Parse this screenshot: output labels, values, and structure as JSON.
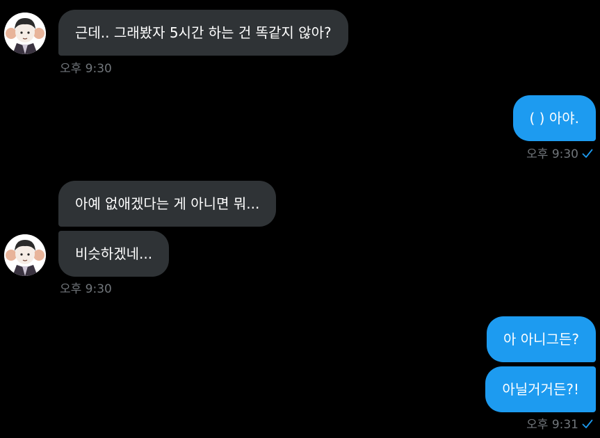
{
  "messages": [
    {
      "direction": "in",
      "text": "근데.. 그래봤자 5시간 하는 건 똑같지 않아?",
      "time": "오후 9:30"
    },
    {
      "direction": "out",
      "text": "( ) 아야.",
      "time": "오후 9:30"
    },
    {
      "direction": "in",
      "text": "아예 없애겠다는 게 아니면 뭐..."
    },
    {
      "direction": "in",
      "text": "비슷하겠네...",
      "time": "오후 9:30"
    },
    {
      "direction": "out",
      "text": "아 아니그든?"
    },
    {
      "direction": "out",
      "text": "아닐거거든?!",
      "time": "오후 9:31"
    }
  ],
  "icons": {
    "read_receipt": "check-icon",
    "avatar": "avatar-icon"
  },
  "colors": {
    "background": "#000000",
    "incoming_bubble": "#2f3336",
    "outgoing_bubble": "#1d9bf0",
    "timestamp": "#71767b",
    "check": "#1d9bf0"
  }
}
